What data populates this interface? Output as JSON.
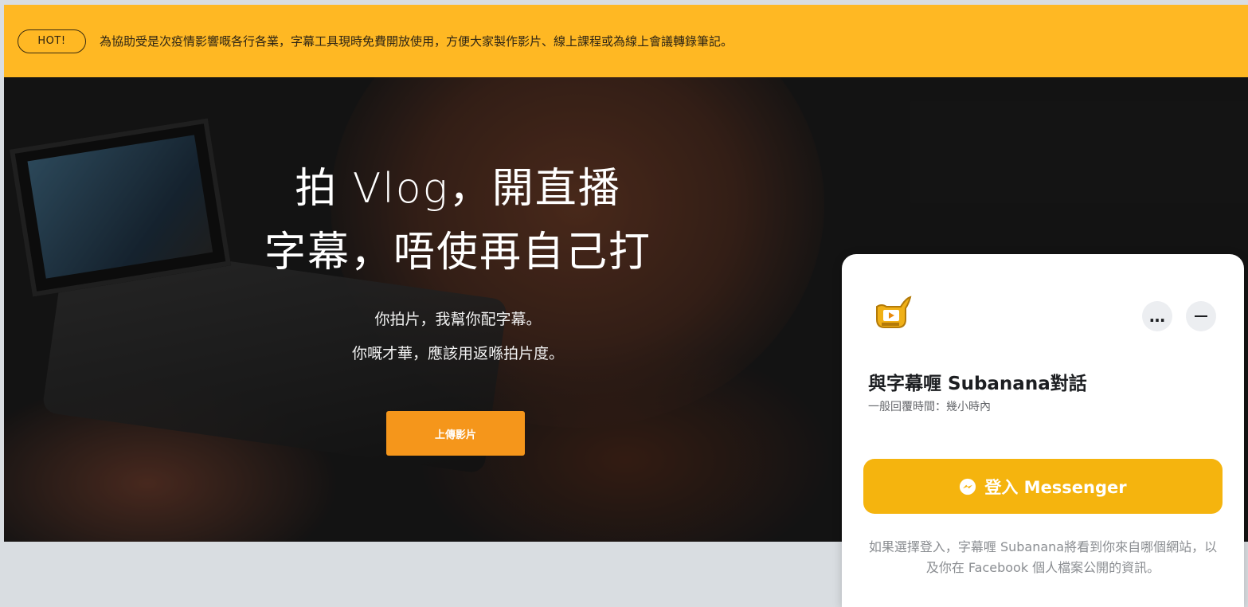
{
  "announcement": {
    "badge": "HOT!",
    "text": "為協助受是次疫情影響嘅各行各業，字幕工具現時免費開放使用，方便大家製作影片、線上課程或為線上會議轉錄筆記。"
  },
  "hero": {
    "title_line1": "拍 Vlog，開直播",
    "title_line2": "字幕，唔使再自己打",
    "subtitle_line1": "你拍片，我幫你配字幕。",
    "subtitle_line2": "你嘅才華，應該用返喺拍片度。",
    "upload_button": "上傳影片"
  },
  "chat": {
    "logo_icon": "subanana-logo-icon",
    "more_icon": "more-options-icon",
    "minimize_icon": "minimize-icon",
    "title": "與字幕喱 Subanana對話",
    "reply_time": "一般回覆時間：幾小時內",
    "login_button": "登入 Messenger",
    "login_icon": "messenger-icon",
    "disclaimer": "如果選擇登入，字幕喱 Subanana將看到你來自哪個網站，以及你在 Facebook 個人檔案公開的資訊。"
  },
  "colors": {
    "announcement_bg": "#ffb823",
    "upload_button": "#f5961b",
    "login_button": "#f5b40e"
  }
}
